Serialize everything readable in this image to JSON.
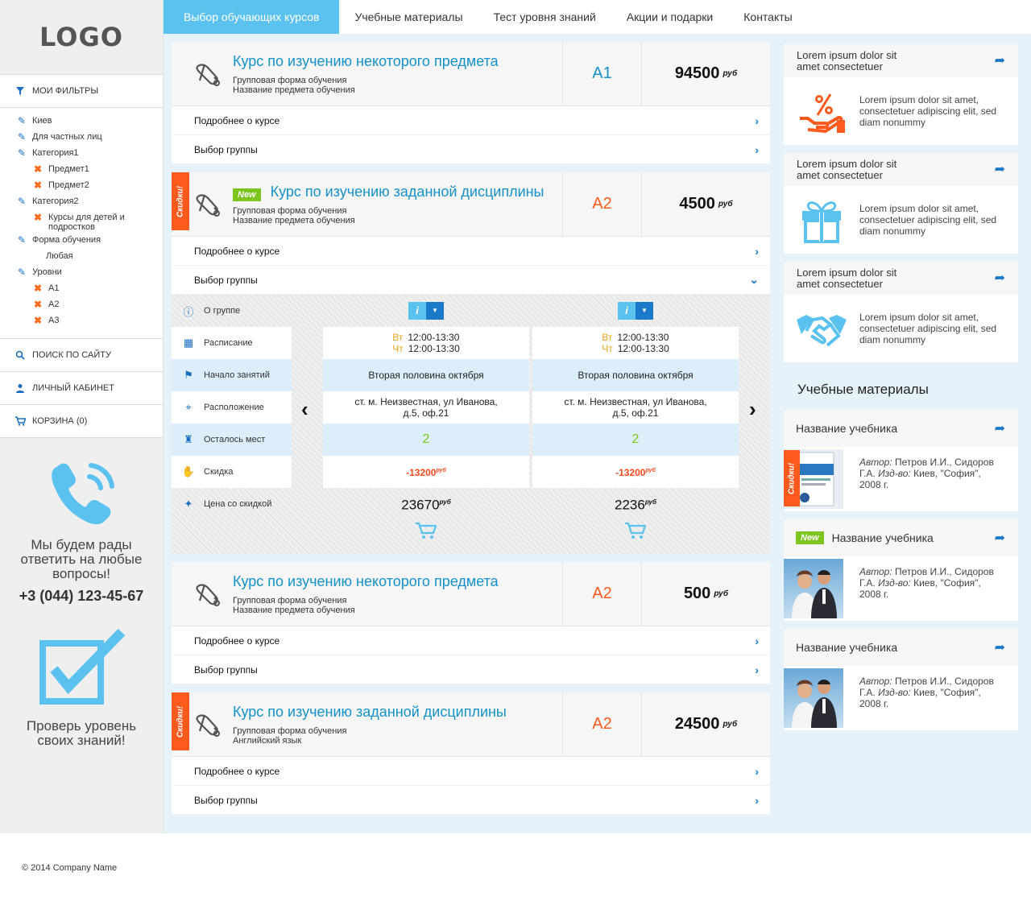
{
  "logo": "LOGO",
  "nav": [
    "Выбор обучающих курсов",
    "Учебные материалы",
    "Тест уровня знаний",
    "Акции и подарки",
    "Контакты"
  ],
  "sidebar": {
    "filters_title": "Мои фильтры",
    "filters": [
      {
        "label": "Киев",
        "type": "pencil",
        "level": 1
      },
      {
        "label": "Для частных лиц",
        "type": "pencil",
        "level": 1
      },
      {
        "label": "Категория1",
        "type": "pencil",
        "level": 1
      },
      {
        "label": "Предмет1",
        "type": "x",
        "level": 2
      },
      {
        "label": "Предмет2",
        "type": "x",
        "level": 2
      },
      {
        "label": "Категория2",
        "type": "pencil",
        "level": 1
      },
      {
        "label": "Курсы для детей и подростков",
        "type": "x",
        "level": 2
      },
      {
        "label": "Форма обучения",
        "type": "pencil",
        "level": 1
      },
      {
        "label": "Любая",
        "type": "none",
        "level": 3
      },
      {
        "label": "Уровни",
        "type": "pencil",
        "level": 1
      },
      {
        "label": "A1",
        "type": "x",
        "level": 2
      },
      {
        "label": "A2",
        "type": "x",
        "level": 2
      },
      {
        "label": "A3",
        "type": "x",
        "level": 2
      }
    ],
    "search": "Поиск по сайту",
    "cabinet": "Личный кабинет",
    "cart": "Корзина (0)",
    "phone_text": "Мы будем рады ответить на любые вопросы!",
    "phone": "+3 (044) 123-45-67",
    "check_text": "Проверь уровень своих знаний!"
  },
  "courses": [
    {
      "title": "Курс по изучению некоторого предмета",
      "sub1": "Групповая форма обучения",
      "sub2": "Название предмета обучения",
      "level": "A1",
      "level_color": "#1591c9",
      "price": "94500",
      "currency": "руб",
      "new": false,
      "ribbon": false
    },
    {
      "title": "Курс по изучению заданной дисциплины",
      "sub1": "Групповая форма обучения",
      "sub2": "Название предмета обучения",
      "level": "A2",
      "level_color": "#ff5a1e",
      "price": "4500",
      "currency": "руб",
      "new": true,
      "ribbon": true
    },
    {
      "title": "Курс по изучению некоторого предмета",
      "sub1": "Групповая форма обучения",
      "sub2": "Название предмета обучения",
      "level": "A2",
      "level_color": "#ff5a1e",
      "price": "500",
      "currency": "руб",
      "new": false,
      "ribbon": false
    },
    {
      "title": "Курс по изучению заданной дисциплины",
      "sub1": "Групповая форма обучения",
      "sub2": "Английский язык",
      "level": "A2",
      "level_color": "#ff5a1e",
      "price": "24500",
      "currency": "руб",
      "new": false,
      "ribbon": true
    }
  ],
  "course_more": "Подробнее о курсе",
  "course_group": "Выбор группы",
  "new_label": "New",
  "ribbon_label": "Скидки!",
  "group_table": {
    "labels": [
      "О группе",
      "Расписание",
      "Начало занятий",
      "Расположение",
      "Осталось мест",
      "Скидка",
      "Цена со скидкой"
    ],
    "groups": [
      {
        "day1": "Вт",
        "time1": "12:00-13:30",
        "day2": "Чт",
        "time2": "12:00-13:30",
        "start": "Вторая половина октября",
        "location": "ст. м. Неизвестная, ул Иванова, д.5, оф.21",
        "seats": "2",
        "discount": "-13200",
        "final": "23670"
      },
      {
        "day1": "Вт",
        "time1": "12:00-13:30",
        "day2": "Чт",
        "time2": "12:00-13:30",
        "start": "Вторая половина октября",
        "location": "ст. м. Неизвестная, ул Иванова, д.5, оф.21",
        "seats": "2",
        "discount": "-13200",
        "final": "2236"
      }
    ],
    "currency": "руб"
  },
  "promos": [
    {
      "title": "Lorem ipsum dolor sit amet consectetuer",
      "text": "Lorem ipsum dolor sit amet, consectetuer adipiscing elit, sed diam nonummy",
      "icon": "percent-hand-icon"
    },
    {
      "title": "Lorem ipsum dolor sit amet consectetuer",
      "text": "Lorem ipsum dolor sit amet, consectetuer adipiscing elit, sed diam nonummy",
      "icon": "gift-icon"
    },
    {
      "title": "Lorem ipsum dolor sit amet consectetuer",
      "text": "Lorem ipsum dolor sit amet, consectetuer adipiscing elit, sed diam nonummy",
      "icon": "handshake-icon"
    }
  ],
  "materials_title": "Учебные материалы",
  "books": [
    {
      "title": "Название учебника",
      "author_label": "Автор:",
      "author": "Петров И.И., Сидоров Г.А.",
      "pub_label": "Изд-во:",
      "pub": "Киев, \"София\", 2008 г.",
      "new": false,
      "ribbon": true,
      "img": "book-cover"
    },
    {
      "title": "Название учебника",
      "author_label": "Автор:",
      "author": "Петров И.И., Сидоров Г.А.",
      "pub_label": "Изд-во:",
      "pub": "Киев, \"София\", 2008 г.",
      "new": true,
      "ribbon": false,
      "img": "people-photo"
    },
    {
      "title": "Название учебника",
      "author_label": "Автор:",
      "author": "Петров И.И., Сидоров Г.А.",
      "pub_label": "Изд-во:",
      "pub": "Киев, \"София\", 2008 г.",
      "new": false,
      "ribbon": false,
      "img": "people-photo"
    }
  ],
  "footer": "© 2014 Company Name"
}
